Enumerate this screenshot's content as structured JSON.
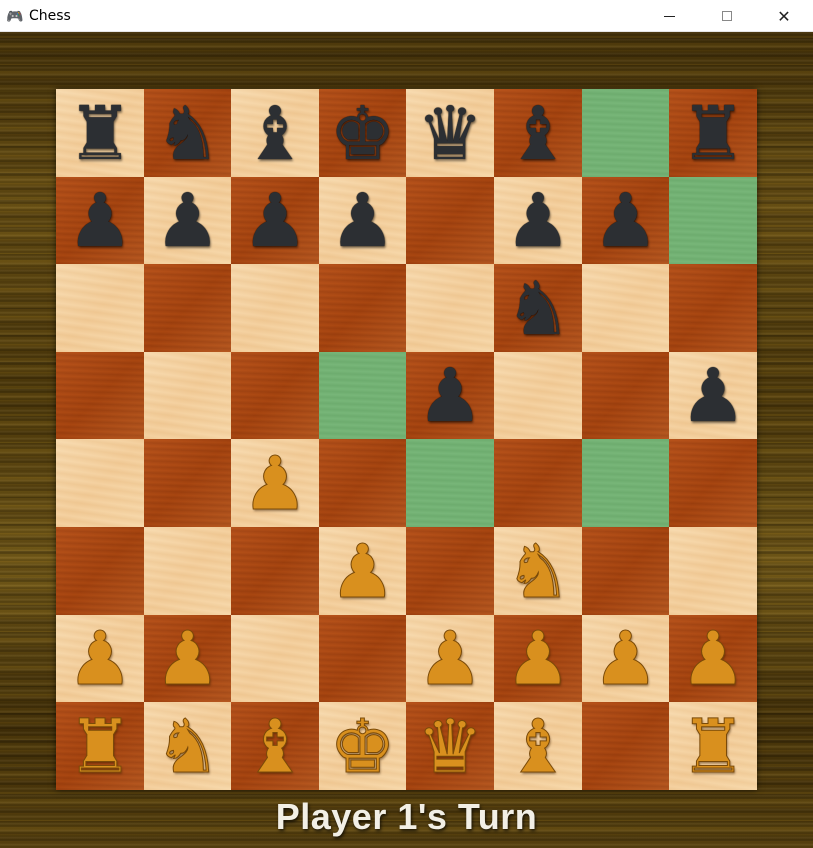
{
  "window": {
    "title": "Chess",
    "app_icon": "gamepad-icon",
    "controls": {
      "minimize": "minimize-icon",
      "maximize": "maximize-icon",
      "close": "✕"
    }
  },
  "board": {
    "files": 8,
    "ranks": 8,
    "orientation": "black-top",
    "highlight_color": "#72b373",
    "rows": [
      [
        "bR",
        "bN",
        "bB",
        "bK",
        "bQ",
        "bB",
        "",
        "bR"
      ],
      [
        "bP",
        "bP",
        "bP",
        "bP",
        "",
        "bP",
        "bP",
        ""
      ],
      [
        "",
        "",
        "",
        "",
        "",
        "bN",
        "",
        ""
      ],
      [
        "",
        "",
        "",
        "",
        "bP",
        "",
        "",
        "bP"
      ],
      [
        "",
        "",
        "wP",
        "",
        "",
        "",
        "",
        ""
      ],
      [
        "",
        "",
        "",
        "wP",
        "",
        "wN",
        "",
        ""
      ],
      [
        "wP",
        "wP",
        "",
        "",
        "wP",
        "wP",
        "wP",
        "wP"
      ],
      [
        "wR",
        "wN",
        "wB",
        "wK",
        "wQ",
        "wB",
        "",
        "wR"
      ]
    ],
    "highlighted_squares": [
      [
        0,
        6
      ],
      [
        1,
        7
      ],
      [
        3,
        3
      ],
      [
        4,
        4
      ],
      [
        4,
        6
      ]
    ],
    "piece_glyphs": {
      "K": "♚",
      "Q": "♛",
      "R": "♜",
      "B": "♝",
      "N": "♞",
      "P": "♟"
    }
  },
  "status": {
    "text": "Player 1's Turn"
  }
}
